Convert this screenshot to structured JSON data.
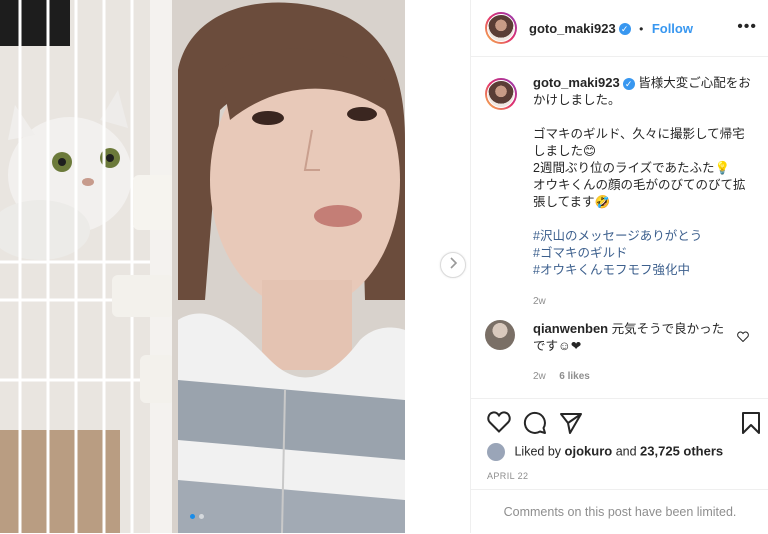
{
  "post": {
    "author": "goto_maki923",
    "follow_label": "Follow",
    "more_label": "•••",
    "separator": "•"
  },
  "caption": {
    "username": "goto_maki923",
    "line1": "皆様大変ご心配をおかけしました。",
    "line2": "ゴマキのギルド、久々に撮影して帰宅しました😊",
    "line3": "2週間ぶり位のライズであたふた💡",
    "line4": "オウキくんの顔の毛がのびてのびて拡張してます🤣",
    "hashtags": [
      "#沢山のメッセージありがとう",
      "#ゴマキのギルド",
      "#オウキくんモフモフ強化中"
    ],
    "time": "2w"
  },
  "comment": {
    "username": "qianwenben",
    "text": "元気そうで良かったです☺❤",
    "time": "2w",
    "likes": "6 likes"
  },
  "likes": {
    "prefix": "Liked by",
    "user": "ojokuro",
    "connector": "and",
    "others": "23,725 others"
  },
  "date": "APRIL 22",
  "comments_limited": "Comments on this post have been limited.",
  "colors": {
    "accent": "#3897f0",
    "hashtag": "#3c5f8d",
    "muted": "#8e8e8e"
  },
  "icons": [
    "heart-icon",
    "comment-icon",
    "share-icon",
    "bookmark-icon",
    "chevron-right-icon",
    "verified-icon"
  ]
}
